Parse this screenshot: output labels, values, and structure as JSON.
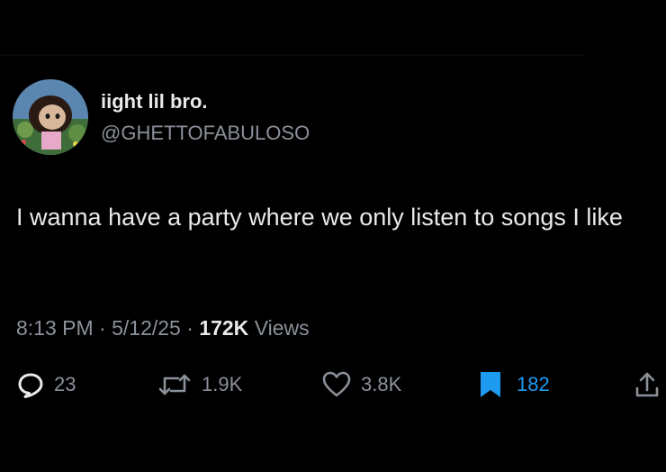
{
  "user": {
    "display_name": "iight lil bro.",
    "handle": "@GHETTOFABULOSO"
  },
  "tweet": {
    "text": "I wanna have a party where we only listen to songs I like"
  },
  "meta": {
    "time": "8:13 PM",
    "date": "5/12/25",
    "separator": "·",
    "views_count": "172K",
    "views_label": "Views"
  },
  "actions": {
    "replies": "23",
    "reposts": "1.9K",
    "likes": "3.8K",
    "bookmarks": "182"
  },
  "colors": {
    "background": "#000000",
    "text_primary": "#e7e9ea",
    "text_secondary": "#8b9199",
    "accent": "#1d9bf0"
  },
  "icons": {
    "reply": "reply-icon",
    "repost": "repost-icon",
    "like": "heart-icon",
    "bookmark": "bookmark-icon",
    "share": "share-icon"
  }
}
